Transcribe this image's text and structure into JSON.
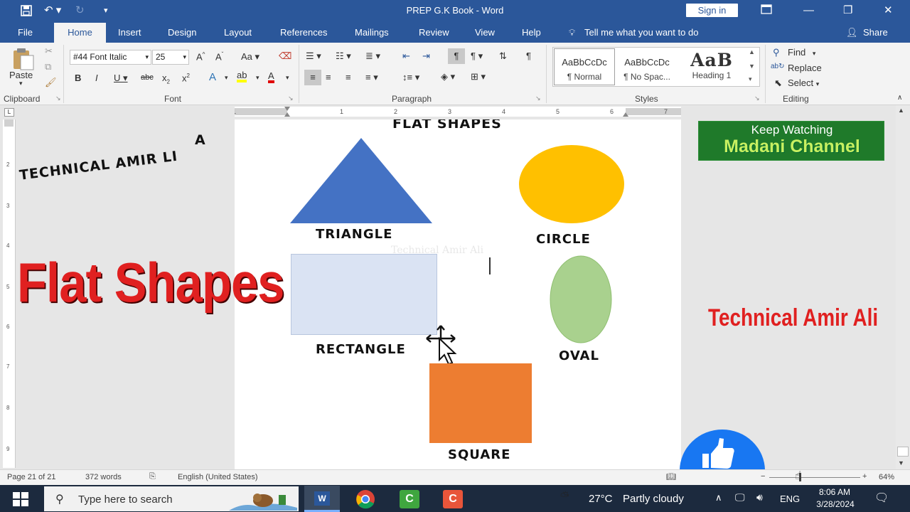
{
  "title_bar": {
    "doc_title": "PREP G.K Book  -  Word",
    "sign_in": "Sign in"
  },
  "tabs": [
    "File",
    "Home",
    "Insert",
    "Design",
    "Layout",
    "References",
    "Mailings",
    "Review",
    "View",
    "Help"
  ],
  "tell_me": "Tell me what you want to do",
  "share": "Share",
  "clipboard": {
    "paste": "Paste",
    "group_label": "Clipboard"
  },
  "font": {
    "name": "#44 Font Italic",
    "size": "25",
    "group_label": "Font"
  },
  "paragraph": {
    "group_label": "Paragraph"
  },
  "styles": {
    "items": [
      {
        "preview": "AaBbCcDc",
        "name": "¶ Normal"
      },
      {
        "preview": "AaBbCcDc",
        "name": "¶ No Spac..."
      },
      {
        "preview": "AaB",
        "name": "Heading 1"
      }
    ],
    "group_label": "Styles"
  },
  "editing": {
    "find": "Find",
    "replace": "Replace",
    "select": "Select",
    "group_label": "Editing"
  },
  "document": {
    "heading": "FLAT SHAPES",
    "labels": {
      "triangle": "TRIANGLE",
      "circle": "CIRCLE",
      "rectangle": "RECTANGLE",
      "oval": "OVAL",
      "square": "SQUARE"
    },
    "watermark": "Technical Amir Ali"
  },
  "overlay": {
    "letter_a": "A",
    "technical": "TECHNICAL AMIR   LI",
    "flat_shapes": "Flat Shapes",
    "keep_watching": "Keep Watching",
    "madani": "Madani Channel",
    "tech_amir": "Technical Amir Ali"
  },
  "status": {
    "page": "Page 21 of 21",
    "words": "372 words",
    "language": "English (United States)",
    "zoom": "64%"
  },
  "taskbar": {
    "search": "Type here to search",
    "weather_temp": "27°C",
    "weather_desc": "Partly cloudy",
    "lang": "ENG",
    "time": "8:06 AM",
    "date": "3/28/2024"
  },
  "colors": {
    "word_blue": "#2b579a",
    "triangle": "#4472c4",
    "circle": "#ffc000",
    "rectangle": "#dae3f3",
    "oval": "#a9d18e",
    "square": "#ed7d31",
    "overlay_red": "#e02020"
  }
}
